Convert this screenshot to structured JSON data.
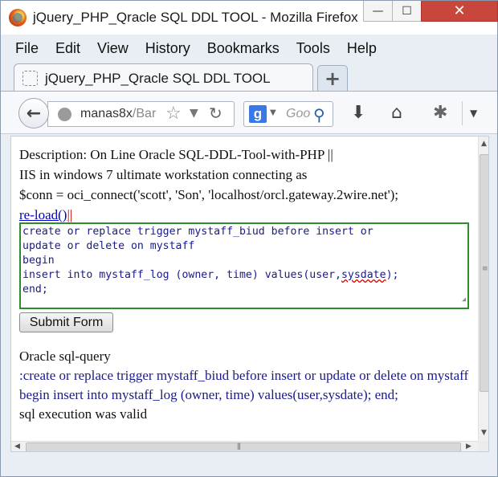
{
  "window": {
    "title": "jQuery_PHP_Qracle SQL DDL TOOL - Mozilla Firefox",
    "minimize_glyph": "—",
    "maximize_glyph": "☐",
    "close_glyph": "✕"
  },
  "menubar": {
    "items": [
      "File",
      "Edit",
      "View",
      "History",
      "Bookmarks",
      "Tools",
      "Help"
    ]
  },
  "tabs": [
    {
      "label": "jQuery_PHP_Qracle SQL DDL TOOL",
      "active": true
    }
  ],
  "newtab_glyph": "+",
  "navbar": {
    "back_glyph": "←",
    "url_host": "manas8x",
    "url_path": "/Bar",
    "search_engine": "g",
    "search_placeholder": "Goo"
  },
  "page": {
    "description": "Description: On Line Oracle SQL-DDL-Tool-with-PHP ||",
    "line2": "IIS in windows 7 ultimate workstation connecting as",
    "line3": "$conn = oci_connect('scott', 'Son', 'localhost/orcl.gateway.2wire.net');",
    "reload_label": "re-load()",
    "reload_sep": "||",
    "sql_lines": [
      "create or replace trigger mystaff_biud before insert or",
      "update or delete on mystaff",
      "begin",
      "insert into mystaff_log (owner, time) values(user,",
      "end;"
    ],
    "sql_misspelled": "sysdate",
    "sql_line4_tail": ");",
    "submit_label": "Submit Form",
    "result_heading": "Oracle sql-query",
    "result_query": ":create or replace trigger mystaff_biud before insert or update or delete on mystaff begin insert into mystaff_log (owner, time) values(user,sysdate); end;",
    "result_status": "sql execution was valid"
  },
  "colors": {
    "link": "#0000cc",
    "query_text": "#1a1a8c",
    "textarea_border": "#2e8b2e",
    "close_button": "#c9463d"
  }
}
